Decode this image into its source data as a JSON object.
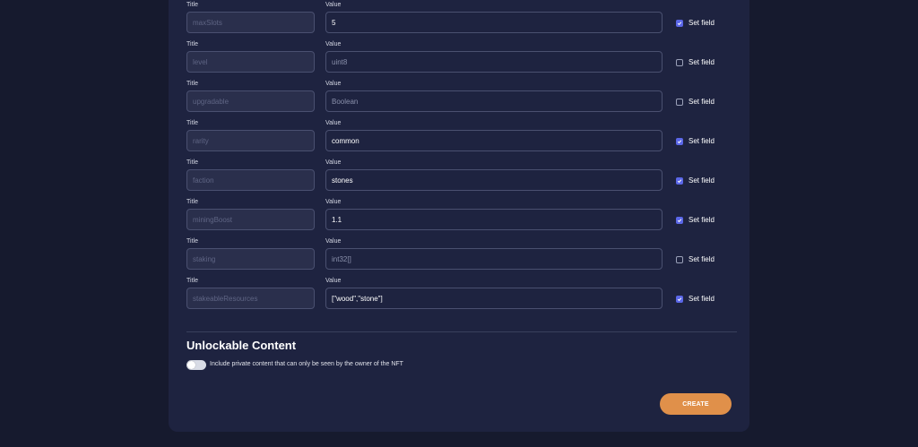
{
  "rows": [
    {
      "title_label": "Title",
      "value_label": "Value",
      "title": "maxSlots",
      "value": "5",
      "placeholder": false,
      "set_label": "Set field",
      "checked": true
    },
    {
      "title_label": "Title",
      "value_label": "Value",
      "title": "level",
      "value": "uint8",
      "placeholder": true,
      "set_label": "Set field",
      "checked": false
    },
    {
      "title_label": "Title",
      "value_label": "Value",
      "title": "upgradable",
      "value": "Boolean",
      "placeholder": true,
      "set_label": "Set field",
      "checked": false
    },
    {
      "title_label": "Title",
      "value_label": "Value",
      "title": "rarity",
      "value": "common",
      "placeholder": false,
      "set_label": "Set field",
      "checked": true
    },
    {
      "title_label": "Title",
      "value_label": "Value",
      "title": "faction",
      "value": "stones",
      "placeholder": false,
      "set_label": "Set field",
      "checked": true
    },
    {
      "title_label": "Title",
      "value_label": "Value",
      "title": "miningBoost",
      "value": "1.1",
      "placeholder": false,
      "set_label": "Set field",
      "checked": true
    },
    {
      "title_label": "Title",
      "value_label": "Value",
      "title": "staking",
      "value": "int32[]",
      "placeholder": true,
      "set_label": "Set field",
      "checked": false
    },
    {
      "title_label": "Title",
      "value_label": "Value",
      "title": "stakeableResources",
      "value": "[\"wood\",\"stone\"]",
      "placeholder": false,
      "set_label": "Set field",
      "checked": true
    }
  ],
  "unlockable": {
    "heading": "Unlockable Content",
    "toggle_label": "Include private content that can only be seen by the owner of the NFT",
    "enabled": false
  },
  "create_label": "CREATE",
  "colors": {
    "accent": "#5b67e8",
    "button": "#e0904a",
    "card": "#1e2340",
    "page": "#161a2e"
  }
}
